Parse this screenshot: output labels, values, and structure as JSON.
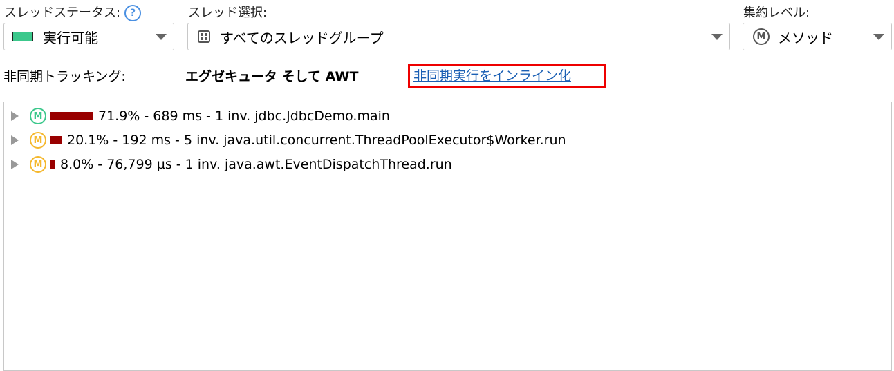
{
  "thread_status": {
    "label": "スレッドステータス:",
    "value": "実行可能",
    "color": "#3cc88c"
  },
  "thread_select": {
    "label": "スレッド選択:",
    "value": "すべてのスレッドグループ"
  },
  "aggregation": {
    "label": "集約レベル:",
    "value": "メソッド"
  },
  "async": {
    "label": "非同期トラッキング:",
    "value": "エグゼキュータ そして AWT",
    "link": "非同期実行をインライン化"
  },
  "nodes": [
    {
      "percent": 71.9,
      "text": "71.9% - 689 ms - 1 inv. jdbc.JdbcDemo.main",
      "icon_color": "#3cc88c"
    },
    {
      "percent": 20.1,
      "text": "20.1% - 192 ms - 5 inv. java.util.concurrent.ThreadPoolExecutor$Worker.run",
      "icon_color": "#f5b82e"
    },
    {
      "percent": 8.0,
      "text": "8.0% - 76,799 µs - 1 inv. java.awt.EventDispatchThread.run",
      "icon_color": "#f5b82e"
    }
  ],
  "method_icon_letter": "M"
}
